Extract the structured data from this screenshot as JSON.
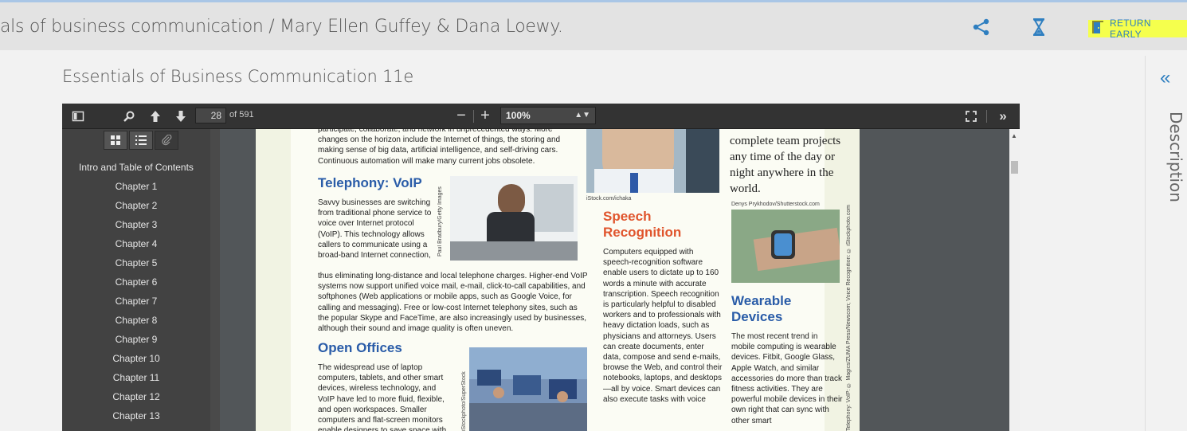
{
  "header": {
    "title": "als of business communication / Mary Ellen Guffey & Dana Loewy.",
    "share_icon": "share-icon",
    "loan_icon": "hourglass-icon",
    "return_label": "RETURN EARLY",
    "accent": "#2f7fc0",
    "highlight": "#f5ff4d"
  },
  "content": {
    "book_title": "Essentials of Business Communication 11e"
  },
  "rightpanel": {
    "collapse_glyph": "«",
    "description_label": "Description"
  },
  "viewer": {
    "toolbar": {
      "sidebar_toggle_icon": "sidebar-toggle-icon",
      "search_icon": "search-icon",
      "prev_icon": "arrow-up-icon",
      "next_icon": "arrow-down-icon",
      "page_value": "28",
      "page_count": "of 591",
      "zoom_out": "−",
      "zoom_in": "+",
      "zoom_value": "100%",
      "fullscreen_icon": "fullscreen-icon",
      "tools_icon": "double-chevron-right-icon"
    },
    "sidebar": {
      "outline": [
        "Intro and Table of Contents",
        "Chapter 1",
        "Chapter 2",
        "Chapter 3",
        "Chapter 4",
        "Chapter 5",
        "Chapter 6",
        "Chapter 7",
        "Chapter 8",
        "Chapter 9",
        "Chapter 10",
        "Chapter 11",
        "Chapter 12",
        "Chapter 13"
      ]
    },
    "page": {
      "intro_text": "participate, collaborate, and network in unprecedented ways. More changes on the horizon include the Internet of things, the storing and making sense of big data, artificial intelligence, and self-driving cars. Continuous automation will make many current jobs obsolete.",
      "telephony_head": "Telephony: VoIP",
      "telephony_text": "Savvy businesses are switching from traditional phone service to voice over Internet protocol (VoIP). This technology allows callers to communicate using a broad-band Internet connection,",
      "telephony_text2": "thus eliminating long-distance and local telephone charges. Higher-end VoIP systems now support unified voice mail, e-mail, click-to-call capabilities, and softphones (Web applications or mobile apps, such as Google Voice, for calling and messaging). Free or low-cost Internet telephony sites, such as the popular Skype and FaceTime, are also increasingly used by businesses, although their sound and image quality is often uneven.",
      "telephony_credit": "Paul Bradbury/Getty Images",
      "open_head": "Open Offices",
      "open_text": "The widespread use of laptop computers, tablets, and other smart devices, wireless technology, and VoIP have led to more fluid, flexible, and open workspaces. Smaller computers and flat-screen monitors enable designers to save space with",
      "open_credit": "iStockphoto/SuperStock",
      "istock_credit": "iStock.com/ichaka",
      "speech_head": "Speech Recognition",
      "speech_text": "Computers equipped with speech-recognition software enable users to dictate up to 160 words a minute with accurate transcription. Speech recognition is particularly helpful to disabled workers and to professionals with heavy dictation loads, such as physicians and attorneys. Users can create documents, enter data, compose and send e-mails, browse the Web, and control their notebooks, laptops, and desktops—all by voice. Smart devices can also execute tasks with voice",
      "quote_text": "complete team projects any time of the day or night anywhere in the world.",
      "denys_credit": "Denys Prykhodov/Shutterstock.com",
      "wearable_head": "Wearable Devices",
      "wearable_text": "The most recent trend in mobile computing is wearable devices. Fitbit, Google Glass, Apple Watch, and similar accessories do more than track fitness activities. They are powerful mobile devices in their own right that can sync with other smart",
      "side_credit": "Telephony: VoIP: © Magics/ZUMA Press/Newscom; Voice Recognition: © iStockphoto.com"
    }
  }
}
